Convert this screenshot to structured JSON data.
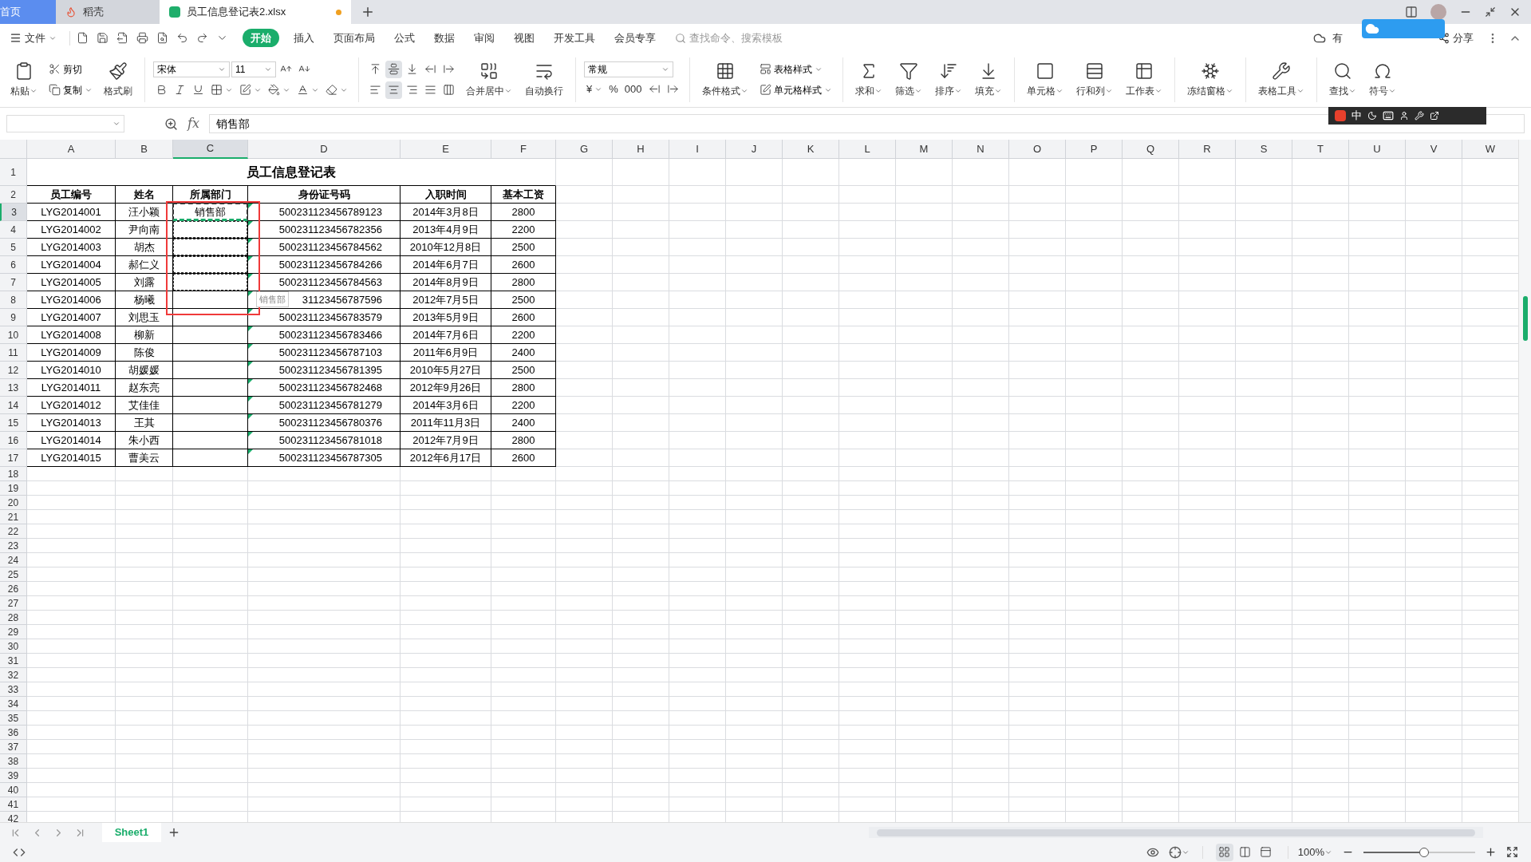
{
  "tabs": [
    {
      "label": "首页",
      "kind": "home",
      "selected": false
    },
    {
      "label": "稻壳",
      "kind": "docer",
      "selected": false
    },
    {
      "label": "员工信息登记表2.xlsx",
      "kind": "sheet",
      "selected": true,
      "unsaved": true
    }
  ],
  "menu": {
    "file": "文件",
    "items": [
      {
        "label": "开始",
        "selected": true
      },
      {
        "label": "插入",
        "selected": false
      },
      {
        "label": "页面布局",
        "selected": false
      },
      {
        "label": "公式",
        "selected": false
      },
      {
        "label": "数据",
        "selected": false
      },
      {
        "label": "审阅",
        "selected": false
      },
      {
        "label": "视图",
        "selected": false
      },
      {
        "label": "开发工具",
        "selected": false
      },
      {
        "label": "会员专享",
        "selected": false
      }
    ],
    "search": {
      "placeholder": "查找命令、搜索模板"
    },
    "cloud": "有",
    "share": "分享"
  },
  "ribbon": [
    {
      "kind": "large",
      "label": "粘贴",
      "menu": true
    },
    {
      "kind": "stack",
      "rows": [
        [
          {
            "kind": "button",
            "label": "剪切",
            "menu": false
          }
        ],
        [
          {
            "kind": "button",
            "label": "复制",
            "menu": true
          }
        ]
      ]
    },
    {
      "kind": "large",
      "label": "格式刷",
      "menu": false
    },
    {
      "kind": "divider"
    },
    {
      "kind": "stack",
      "rows": [
        [
          {
            "kind": "select",
            "value": "宋体"
          },
          {
            "kind": "select",
            "value": "11"
          },
          {
            "kind": "button",
            "menu": false
          },
          {
            "kind": "button",
            "menu": false
          }
        ],
        [
          {
            "kind": "button",
            "menu": false
          },
          {
            "kind": "button",
            "menu": false
          },
          {
            "kind": "button",
            "menu": false
          },
          {
            "kind": "button",
            "menu": true
          },
          {
            "kind": "button",
            "menu": true
          },
          {
            "kind": "button",
            "menu": true
          },
          {
            "kind": "button",
            "menu": true
          },
          {
            "kind": "button",
            "menu": true
          }
        ]
      ]
    },
    {
      "kind": "divider"
    },
    {
      "kind": "stack",
      "rows": [
        [
          {
            "kind": "button",
            "selected": false
          },
          {
            "kind": "button",
            "selected": true
          },
          {
            "kind": "button",
            "selected": false
          },
          {
            "kind": "button",
            "selected": false
          },
          {
            "kind": "button",
            "selected": false
          }
        ],
        [
          {
            "kind": "button",
            "selected": false
          },
          {
            "kind": "button",
            "selected": true
          },
          {
            "kind": "button",
            "selected": false
          },
          {
            "kind": "button",
            "selected": false
          },
          {
            "kind": "button",
            "selected": false
          }
        ]
      ]
    },
    {
      "kind": "large",
      "label": "合并居中",
      "menu": true
    },
    {
      "kind": "large",
      "label": "自动换行",
      "menu": false
    },
    {
      "kind": "divider"
    },
    {
      "kind": "stack",
      "rows": [
        [
          {
            "kind": "select",
            "value": "常规"
          }
        ],
        [
          {
            "kind": "button",
            "text": "¥",
            "menu": true
          },
          {
            "kind": "button",
            "text": "%",
            "menu": false
          },
          {
            "kind": "button",
            "text": "000",
            "menu": false
          },
          {
            "kind": "button",
            "menu": false
          },
          {
            "kind": "button",
            "menu": false
          }
        ]
      ]
    },
    {
      "kind": "divider"
    },
    {
      "kind": "large",
      "label": "条件格式",
      "menu": true
    },
    {
      "kind": "stack",
      "rows": [
        [
          {
            "kind": "button",
            "label": "表格样式",
            "menu": true
          }
        ],
        [
          {
            "kind": "button",
            "label": "单元格样式",
            "menu": true
          }
        ]
      ]
    },
    {
      "kind": "divider"
    },
    {
      "kind": "large",
      "label": "求和",
      "menu": true
    },
    {
      "kind": "large",
      "label": "筛选",
      "menu": true
    },
    {
      "kind": "large",
      "label": "排序",
      "menu": true
    },
    {
      "kind": "large",
      "label": "填充",
      "menu": true
    },
    {
      "kind": "divider"
    },
    {
      "kind": "large",
      "label": "单元格",
      "menu": true
    },
    {
      "kind": "large",
      "label": "行和列",
      "menu": true
    },
    {
      "kind": "large",
      "label": "工作表",
      "menu": true
    },
    {
      "kind": "divider"
    },
    {
      "kind": "large",
      "label": "冻结窗格",
      "menu": true
    },
    {
      "kind": "divider"
    },
    {
      "kind": "large",
      "label": "表格工具",
      "menu": true
    },
    {
      "kind": "divider"
    },
    {
      "kind": "large",
      "label": "查找",
      "menu": true
    },
    {
      "kind": "large",
      "label": "符号",
      "menu": true
    }
  ],
  "ime": {
    "mode": "中"
  },
  "formula_bar": {
    "function_label": "fx",
    "value": "销售部"
  },
  "sheet": {
    "columns": [
      {
        "label": "A",
        "selected": false
      },
      {
        "label": "B",
        "selected": false
      },
      {
        "label": "C",
        "selected": true
      },
      {
        "label": "D",
        "selected": false
      },
      {
        "label": "E",
        "selected": false
      },
      {
        "label": "F",
        "selected": false
      },
      {
        "label": "G",
        "selected": false
      },
      {
        "label": "H",
        "selected": false
      },
      {
        "label": "I",
        "selected": false
      },
      {
        "label": "J",
        "selected": false
      },
      {
        "label": "K",
        "selected": false
      },
      {
        "label": "L",
        "selected": false
      },
      {
        "label": "M",
        "selected": false
      },
      {
        "label": "N",
        "selected": false
      },
      {
        "label": "O",
        "selected": false
      },
      {
        "label": "P",
        "selected": false
      },
      {
        "label": "Q",
        "selected": false
      },
      {
        "label": "R",
        "selected": false
      },
      {
        "label": "S",
        "selected": false
      },
      {
        "label": "T",
        "selected": false
      },
      {
        "label": "U",
        "selected": false
      },
      {
        "label": "V",
        "selected": false
      },
      {
        "label": "W",
        "selected": false
      }
    ],
    "row_numbers": [
      {
        "label": "1",
        "selected": false
      },
      {
        "label": "2",
        "selected": false
      },
      {
        "label": "3",
        "selected": true
      },
      {
        "label": "4",
        "selected": false
      },
      {
        "label": "5",
        "selected": false
      },
      {
        "label": "6",
        "selected": false
      },
      {
        "label": "7",
        "selected": false
      },
      {
        "label": "8",
        "selected": false
      },
      {
        "label": "9",
        "selected": false
      },
      {
        "label": "10",
        "selected": false
      },
      {
        "label": "11",
        "selected": false
      },
      {
        "label": "12",
        "selected": false
      },
      {
        "label": "13",
        "selected": false
      },
      {
        "label": "14",
        "selected": false
      },
      {
        "label": "15",
        "selected": false
      },
      {
        "label": "16",
        "selected": false
      },
      {
        "label": "17",
        "selected": false
      },
      {
        "label": "18",
        "selected": false
      },
      {
        "label": "19",
        "selected": false
      },
      {
        "label": "20",
        "selected": false
      },
      {
        "label": "21",
        "selected": false
      },
      {
        "label": "22",
        "selected": false
      },
      {
        "label": "23",
        "selected": false
      },
      {
        "label": "24",
        "selected": false
      },
      {
        "label": "25",
        "selected": false
      },
      {
        "label": "26",
        "selected": false
      },
      {
        "label": "27",
        "selected": false
      },
      {
        "label": "28",
        "selected": false
      },
      {
        "label": "29",
        "selected": false
      },
      {
        "label": "30",
        "selected": false
      },
      {
        "label": "31",
        "selected": false
      },
      {
        "label": "32",
        "selected": false
      },
      {
        "label": "33",
        "selected": false
      },
      {
        "label": "34",
        "selected": false
      },
      {
        "label": "35",
        "selected": false
      },
      {
        "label": "36",
        "selected": false
      },
      {
        "label": "37",
        "selected": false
      },
      {
        "label": "38",
        "selected": false
      },
      {
        "label": "39",
        "selected": false
      },
      {
        "label": "40",
        "selected": false
      },
      {
        "label": "41",
        "selected": false
      },
      {
        "label": "42",
        "selected": false
      }
    ],
    "title": "员工信息登记表",
    "header": [
      "员工编号",
      "姓名",
      "所属部门",
      "身份证号码",
      "入职时间",
      "基本工资"
    ],
    "records": [
      {
        "id": "LYG2014001",
        "name": "汪小颖",
        "department": "销售部",
        "id_number": "500231123456789123",
        "hire_date": "2014年3月8日",
        "salary": "2800",
        "copied": true,
        "number_as_text": true
      },
      {
        "id": "LYG2014002",
        "name": "尹向南",
        "id_number": "500231123456782356",
        "hire_date": "2013年4月9日",
        "salary": "2200",
        "copied": true,
        "number_as_text": true
      },
      {
        "id": "LYG2014003",
        "name": "胡杰",
        "id_number": "500231123456784562",
        "hire_date": "2010年12月8日",
        "salary": "2500",
        "copied": true,
        "number_as_text": true
      },
      {
        "id": "LYG2014004",
        "name": "郝仁义",
        "id_number": "500231123456784266",
        "hire_date": "2014年6月7日",
        "salary": "2600",
        "copied": true,
        "number_as_text": true
      },
      {
        "id": "LYG2014005",
        "name": "刘露",
        "id_number": "500231123456784563",
        "hire_date": "2014年8月9日",
        "salary": "2800",
        "copied": true,
        "number_as_text": true
      },
      {
        "id": "LYG2014006",
        "name": "杨曦",
        "id_number": "31123456787596",
        "hire_date": "2012年7月5日",
        "salary": "2500",
        "copied": false,
        "number_as_text": true
      },
      {
        "id": "LYG2014007",
        "name": "刘思玉",
        "id_number": "500231123456783579",
        "hire_date": "2013年5月9日",
        "salary": "2600",
        "copied": false,
        "number_as_text": true
      },
      {
        "id": "LYG2014008",
        "name": "柳新",
        "id_number": "500231123456783466",
        "hire_date": "2014年7月6日",
        "salary": "2200",
        "copied": false,
        "number_as_text": true
      },
      {
        "id": "LYG2014009",
        "name": "陈俊",
        "id_number": "500231123456787103",
        "hire_date": "2011年6月9日",
        "salary": "2400",
        "copied": false,
        "number_as_text": true
      },
      {
        "id": "LYG2014010",
        "name": "胡媛媛",
        "id_number": "500231123456781395",
        "hire_date": "2010年5月27日",
        "salary": "2500",
        "copied": false,
        "number_as_text": true
      },
      {
        "id": "LYG2014011",
        "name": "赵东亮",
        "id_number": "500231123456782468",
        "hire_date": "2012年9月26日",
        "salary": "2800",
        "copied": false,
        "number_as_text": true
      },
      {
        "id": "LYG2014012",
        "name": "艾佳佳",
        "id_number": "500231123456781279",
        "hire_date": "2014年3月6日",
        "salary": "2200",
        "copied": false,
        "number_as_text": true
      },
      {
        "id": "LYG2014013",
        "name": "王其",
        "id_number": "500231123456780376",
        "hire_date": "2011年11月3日",
        "salary": "2400",
        "copied": false,
        "number_as_text": true
      },
      {
        "id": "LYG2014014",
        "name": "朱小西",
        "id_number": "500231123456781018",
        "hire_date": "2012年7月9日",
        "salary": "2800",
        "copied": false,
        "number_as_text": true
      },
      {
        "id": "LYG2014015",
        "name": "曹美云",
        "id_number": "500231123456787305",
        "hire_date": "2012年6月17日",
        "salary": "2600",
        "copied": false,
        "number_as_text": true
      }
    ],
    "paste_hint": "销售部"
  },
  "sheet_tabs": [
    {
      "label": "Sheet1",
      "selected": true
    }
  ],
  "status_bar": {
    "views": [
      {
        "selected": true
      },
      {
        "selected": false
      },
      {
        "selected": false
      }
    ],
    "zoom": "100%",
    "zoom_slider": {
      "level": 0.5
    }
  }
}
